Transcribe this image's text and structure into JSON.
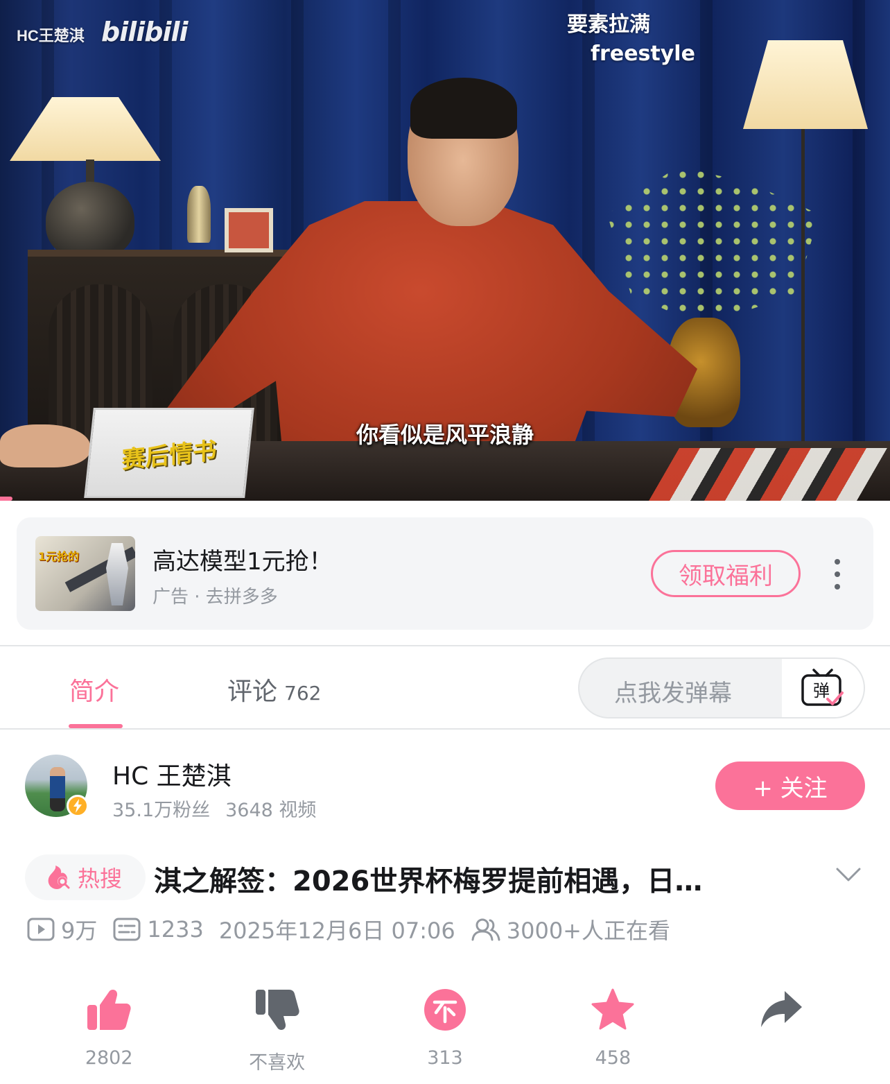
{
  "video": {
    "channel_watermark": "HC王楚淇",
    "platform_watermark": "bilibili",
    "overlay_top_1": "要素拉满",
    "overlay_top_2": "freestyle",
    "subtitle": "你看似是风平浪静",
    "nameplate_text": "赛后情书"
  },
  "ad": {
    "thumb_badge": "1元抢的",
    "title": "高达模型1元抢！",
    "subtitle": "广告 · 去拼多多",
    "button_label": "领取福利"
  },
  "tabs": {
    "intro_label": "简介",
    "comments_label": "评论",
    "comments_count": "762"
  },
  "danmaku": {
    "placeholder": "点我发弹幕",
    "toggle_glyph": "弹"
  },
  "uploader": {
    "name": "HC 王楚淇",
    "followers": "35.1万粉丝",
    "videos": "3648 视频",
    "follow_label": "+ 关注"
  },
  "title_row": {
    "hot_tag_label": "热搜",
    "title": "淇之解签：2026世界杯梅罗提前相遇，日…"
  },
  "meta": {
    "plays": "9万",
    "danmaku_count": "1233",
    "date": "2025年12月6日 07:06",
    "watching": "3000+人正在看"
  },
  "actions": {
    "like": "2802",
    "dislike": "不喜欢",
    "coin": "313",
    "favorite": "458",
    "share": ""
  },
  "colors": {
    "accent": "#fb7299",
    "text_primary": "#18191c",
    "text_secondary": "#9499a0",
    "icon_dark": "#61666d"
  }
}
